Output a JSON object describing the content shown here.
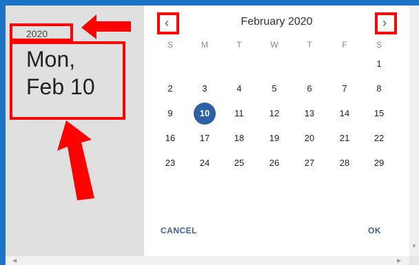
{
  "header": {
    "year": "2020",
    "date_line1": "Mon,",
    "date_line2": "Feb 10"
  },
  "calendar": {
    "month_title": "February 2020",
    "prev_icon": "chevron-left-icon",
    "next_icon": "chevron-right-icon",
    "weekdays": [
      "S",
      "M",
      "T",
      "W",
      "T",
      "F",
      "S"
    ],
    "weeks": [
      [
        "",
        "",
        "",
        "",
        "",
        "",
        "1"
      ],
      [
        "2",
        "3",
        "4",
        "5",
        "6",
        "7",
        "8"
      ],
      [
        "9",
        "10",
        "11",
        "12",
        "13",
        "14",
        "15"
      ],
      [
        "16",
        "17",
        "18",
        "19",
        "20",
        "21",
        "22"
      ],
      [
        "23",
        "24",
        "25",
        "26",
        "27",
        "28",
        "29"
      ]
    ],
    "selected_day": "10"
  },
  "actions": {
    "cancel": "CANCEL",
    "ok": "OK"
  },
  "colors": {
    "accent": "#2f5fa5",
    "frame": "#1a73c4",
    "annotation": "#ff0000",
    "left_pane": "#e0e0e0"
  }
}
